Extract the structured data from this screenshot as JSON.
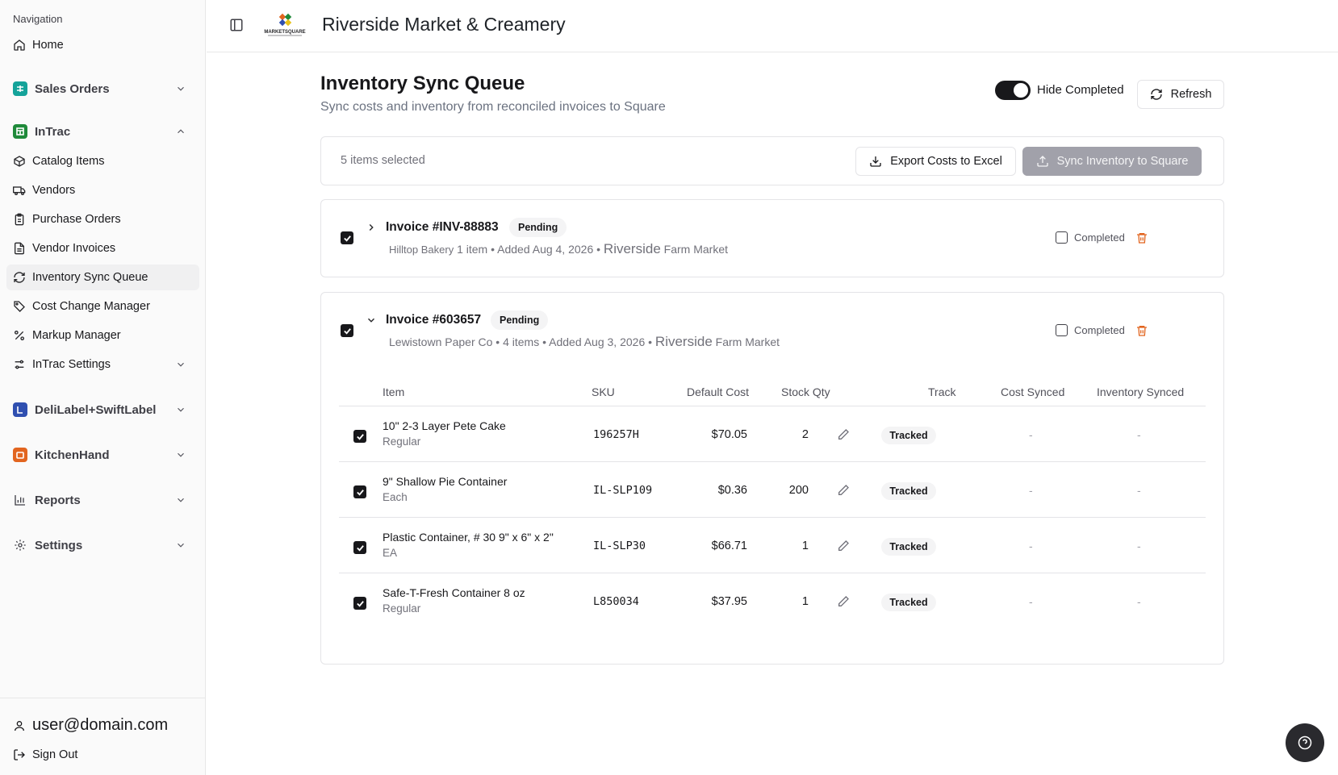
{
  "sidebar": {
    "heading": "Navigation",
    "home": "Home",
    "groups": {
      "sales_orders": "Sales Orders",
      "intrac": "InTrac",
      "delilabel": "DeliLabel+SwiftLabel",
      "kitchenhand": "KitchenHand",
      "reports": "Reports",
      "settings": "Settings"
    },
    "intrac_items": {
      "catalog": "Catalog Items",
      "vendors": "Vendors",
      "purchase_orders": "Purchase Orders",
      "vendor_invoices": "Vendor Invoices",
      "inventory_sync": "Inventory Sync Queue",
      "cost_change": "Cost Change Manager",
      "markup": "Markup Manager",
      "intrac_settings": "InTrac Settings"
    },
    "user_email": "user@domain.com",
    "sign_out": "Sign Out"
  },
  "header": {
    "title": "Riverside Market & Creamery",
    "logo_text": "MARKETSQUARE"
  },
  "page": {
    "title": "Inventory Sync Queue",
    "subtitle": "Sync costs and inventory from reconciled invoices to Square",
    "hide_completed_label": "Hide Completed",
    "hide_completed_on": true,
    "refresh_label": "Refresh"
  },
  "toolbar": {
    "selected_text": "5 items selected",
    "export_label": "Export Costs to Excel",
    "sync_label": "Sync Inventory to Square"
  },
  "invoices": [
    {
      "title": "Invoice #INV-88883",
      "status": "Pending",
      "vendor": "Hilltop Bakery",
      "meta": "1 item • Added Aug 4, 2026 •",
      "location_a": "Riverside",
      "location_b": "Farm Market",
      "completed_label": "Completed"
    },
    {
      "title": "Invoice #603657",
      "status": "Pending",
      "vendor": "Lewistown Paper Co",
      "meta": "• 4 items • Added Aug 3, 2026 •",
      "location_a": "Riverside",
      "location_b": "Farm Market",
      "completed_label": "Completed",
      "columns": [
        "Item",
        "SKU",
        "Default Cost",
        "Stock Qty",
        "Track",
        "Cost Synced",
        "Inventory Synced"
      ],
      "items": [
        {
          "name": "10\" 2-3 Layer Pete Cake",
          "unit": "Regular",
          "sku": "196257H",
          "cost": "$70.05",
          "qty": "2",
          "track": "Tracked",
          "cost_synced": "-",
          "inv_synced": "-"
        },
        {
          "name": "9\" Shallow Pie Container",
          "unit": "Each",
          "sku": "IL-SLP109",
          "cost": "$0.36",
          "qty": "200",
          "track": "Tracked",
          "cost_synced": "-",
          "inv_synced": "-"
        },
        {
          "name": "Plastic Container, # 30 9\" x 6\" x 2\"",
          "unit": "EA",
          "sku": "IL-SLP30",
          "cost": "$66.71",
          "qty": "1",
          "track": "Tracked",
          "cost_synced": "-",
          "inv_synced": "-"
        },
        {
          "name": "Safe-T-Fresh Container 8 oz",
          "unit": "Regular",
          "sku": "L850034",
          "cost": "$37.95",
          "qty": "1",
          "track": "Tracked",
          "cost_synced": "-",
          "inv_synced": "-"
        }
      ]
    }
  ],
  "colors": {
    "accent_dark": "#18181b",
    "trash": "#e2651f",
    "sales_orders_icon": "#14a39a",
    "intrac_icon": "#1f8a3a",
    "delilabel_icon": "#2f4fb0",
    "kitchenhand_icon": "#e2651f"
  }
}
